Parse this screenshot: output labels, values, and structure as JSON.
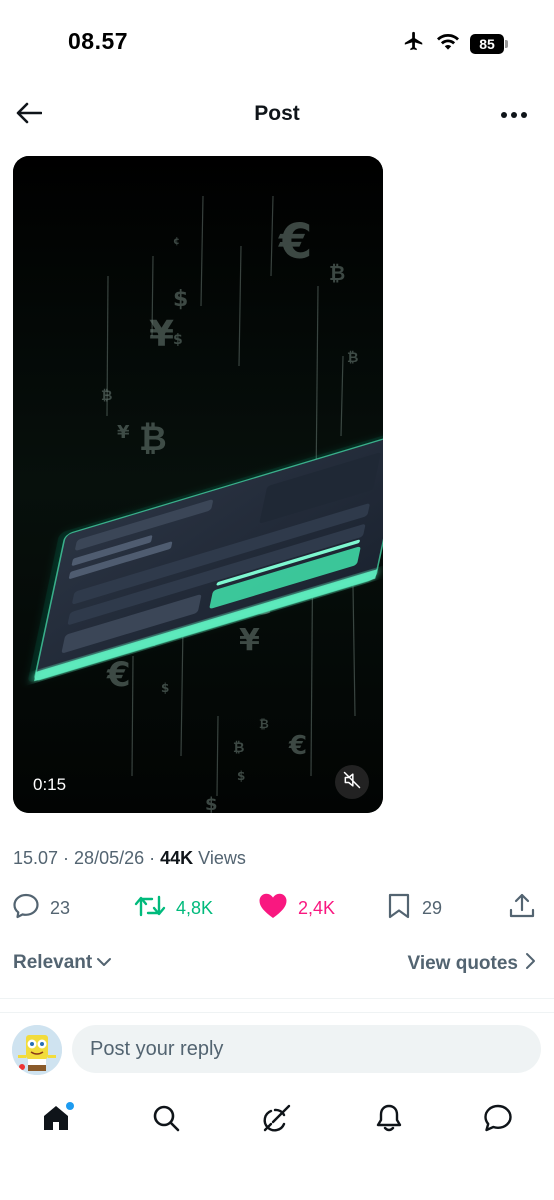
{
  "status_bar": {
    "time": "08.57",
    "battery": "85",
    "icons": [
      "airplane-icon",
      "wifi-icon",
      "battery-icon"
    ]
  },
  "header": {
    "title": "Post",
    "icons": [
      "back-arrow-icon",
      "more-icon"
    ]
  },
  "video": {
    "time": "0:15",
    "muted": true,
    "icons": [
      "mute-icon"
    ]
  },
  "post_meta": {
    "time": "15.07",
    "separator": " · ",
    "date": "28/05/26",
    "views_count": "44K",
    "views_label": " Views"
  },
  "actions": {
    "replies": "23",
    "reposts": "4,8K",
    "likes": "2,4K",
    "bookmarks": "29",
    "colors": {
      "repost": "#00ba7c",
      "like": "#f91880",
      "muted": "#536471"
    }
  },
  "sort": {
    "relevant_label": "Relevant",
    "view_quotes_label": "View quotes"
  },
  "composer": {
    "placeholder": "Post your reply"
  },
  "bottom_nav": {
    "items": [
      "home-icon",
      "search-icon",
      "grok-icon",
      "notifications-icon",
      "messages-icon"
    ],
    "home_has_badge": true
  }
}
